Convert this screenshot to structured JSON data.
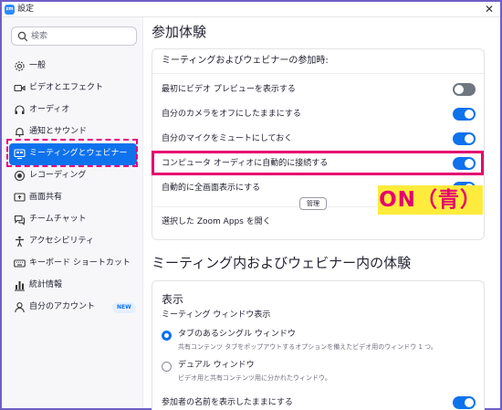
{
  "window": {
    "app_icon": "zm",
    "title": "設定",
    "close_glyph": "✕"
  },
  "sidebar": {
    "search_placeholder": "検索",
    "items": [
      {
        "label": "一般",
        "icon": "gear-icon"
      },
      {
        "label": "ビデオとエフェクト",
        "icon": "video-camera-icon"
      },
      {
        "label": "オーディオ",
        "icon": "headphones-icon"
      },
      {
        "label": "通知とサウンド",
        "icon": "bell-icon"
      },
      {
        "label": "ミーティングとウェビナー",
        "icon": "meeting-icon",
        "active": true
      },
      {
        "label": "レコーディング",
        "icon": "record-icon"
      },
      {
        "label": "画面共有",
        "icon": "screen-share-icon"
      },
      {
        "label": "チームチャット",
        "icon": "chat-icon"
      },
      {
        "label": "アクセシビリティ",
        "icon": "accessibility-icon"
      },
      {
        "label": "キーボード ショートカット",
        "icon": "keyboard-icon"
      },
      {
        "label": "統計情報",
        "icon": "statistics-icon"
      },
      {
        "label": "自分のアカウント",
        "icon": "account-icon",
        "badge": "NEW"
      }
    ]
  },
  "main": {
    "section1_title": "参加体験",
    "card1": {
      "heading": "ミーティングおよびウェビナーの参加時:",
      "rows": [
        {
          "label": "最初にビデオ プレビューを表示する",
          "toggle": "off"
        },
        {
          "label": "自分のカメラをオフにしたままにする",
          "toggle": "on"
        },
        {
          "label": "自分のマイクをミュートにしておく",
          "toggle": "on"
        },
        {
          "label": "コンピュータ オーディオに自動的に接続する",
          "toggle": "on"
        },
        {
          "label": "自動的に全画面表示にする",
          "toggle": "on"
        }
      ],
      "apps_label": "選択した Zoom Apps を開く",
      "manage_button": "管理"
    },
    "annotation_label": "ON（青）",
    "section2_title": "ミーティング内およびウェビナー内の体験",
    "card2": {
      "heading": "表示",
      "sub_label": "ミーティング ウィンドウ表示",
      "options": [
        {
          "label": "タブのあるシングル ウィンドウ",
          "desc": "共有コンテンツ タブをポップアウトするオプションを備えたビデオ用のウィンドウ 1 つ。",
          "checked": true
        },
        {
          "label": "デュアル ウィンドウ",
          "desc": "ビデオ用と共有コンテンツ用に分かれたウィンドウ。",
          "checked": false
        }
      ],
      "names_label": "参加者の名前を表示したままにする",
      "names_toggle": "on"
    }
  },
  "colors": {
    "accent": "#0e72ed",
    "highlight": "#e5006f",
    "annotation_bg": "#ffeb3b",
    "toggle_off": "#6e7680"
  }
}
